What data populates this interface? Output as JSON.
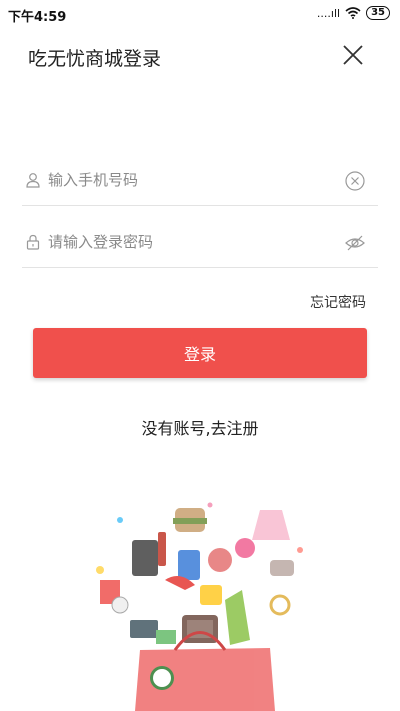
{
  "status_bar": {
    "time": "下午4:59",
    "signal": "....ıll",
    "battery": "35"
  },
  "header": {
    "title": "吃无忧商城登录",
    "close_icon": "close-icon"
  },
  "form": {
    "phone_placeholder": "输入手机号码",
    "phone_value": "",
    "password_placeholder": "请输入登录密码",
    "password_value": "",
    "phone_icon": "user-icon",
    "phone_clear_icon": "clear-icon",
    "password_icon": "lock-icon",
    "password_toggle_icon": "eye-hidden-icon"
  },
  "forgot_password": "忘记密码",
  "login_button": "登录",
  "register_link": "没有账号,去注册",
  "colors": {
    "accent": "#f0504c",
    "divider": "#e3e3e3",
    "text": "#222222"
  }
}
